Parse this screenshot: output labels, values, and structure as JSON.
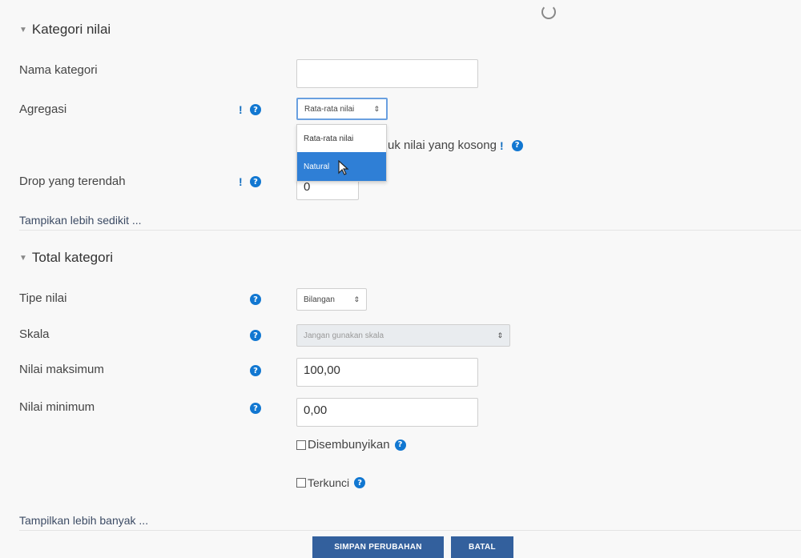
{
  "category_section": {
    "title": "Kategori nilai",
    "name_label": "Nama kategori",
    "name_value": "",
    "aggregation_label": "Agregasi",
    "aggregation_selected": "Rata-rata nilai",
    "aggregation_options": [
      "Rata-rata nilai",
      "Natural"
    ],
    "aggregation_highlighted": "Natural",
    "exclude_empty_label_partial": "uk nilai yang kosong",
    "drop_lowest_label": "Drop yang terendah",
    "drop_lowest_value": "0",
    "show_less_link": "Tampikan lebih sedikit ..."
  },
  "total_section": {
    "title": "Total kategori",
    "grade_type_label": "Tipe nilai",
    "grade_type_value": "Bilangan",
    "scale_label": "Skala",
    "scale_value": "Jangan gunakan skala",
    "max_grade_label": "Nilai maksimum",
    "max_grade_value": "100,00",
    "min_grade_label": "Nilai minimum",
    "min_grade_value": "0,00",
    "hidden_label": "Disembunyikan",
    "locked_label": "Terkunci",
    "show_more_link": "Tampilkan lebih banyak ..."
  },
  "buttons": {
    "save": "SIMPAN PERUBAHAN",
    "cancel": "BATAL"
  },
  "icons": {
    "advanced_marker": "!",
    "help": "?",
    "up_down_caret": "⇕"
  },
  "colors": {
    "accent": "#1177d1",
    "button": "#33609d",
    "highlight": "#2f7fd6"
  }
}
